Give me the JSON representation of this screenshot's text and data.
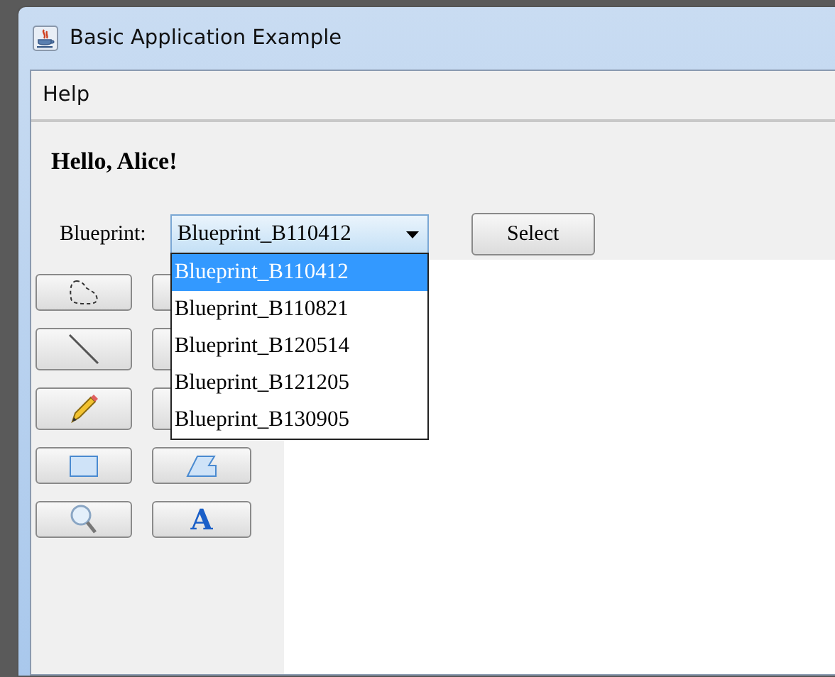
{
  "window": {
    "title": "Basic Application Example"
  },
  "menu": [
    {
      "label": "Help"
    }
  ],
  "greeting": "Hello, Alice!",
  "blueprint": {
    "label": "Blueprint:",
    "value": "Blueprint_B110412",
    "expanded": true,
    "options": [
      {
        "label": "Blueprint_B110412",
        "selected": true
      },
      {
        "label": "Blueprint_B110821",
        "selected": false
      },
      {
        "label": "Blueprint_B120514",
        "selected": false
      },
      {
        "label": "Blueprint_B121205",
        "selected": false
      },
      {
        "label": "Blueprint_B130905",
        "selected": false
      }
    ]
  },
  "select_button": "Select",
  "tools": [
    {
      "kind": "lasso"
    },
    {
      "kind": "covered"
    },
    {
      "kind": "line"
    },
    {
      "kind": "covered"
    },
    {
      "kind": "pencil"
    },
    {
      "kind": "covered"
    },
    {
      "kind": "rectangle"
    },
    {
      "kind": "polygon"
    },
    {
      "kind": "zoom"
    },
    {
      "kind": "text",
      "glyph": "A"
    }
  ]
}
